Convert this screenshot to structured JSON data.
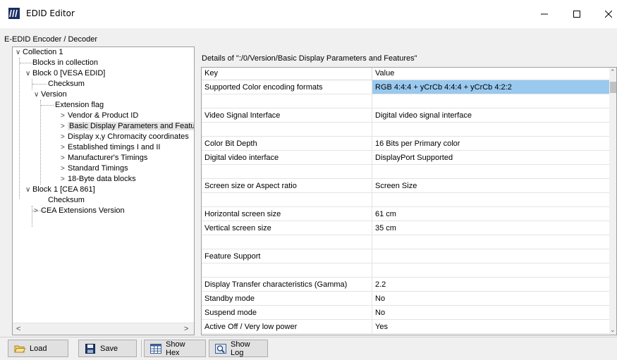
{
  "window": {
    "title": "EDID Editor",
    "subtitle": "E-EDID Encoder / Decoder"
  },
  "tree": {
    "items": [
      {
        "label": "Collection 1",
        "arrow": "∨"
      },
      {
        "label": "Blocks in collection",
        "arrow": ""
      },
      {
        "label": "Block 0 [VESA EDID]",
        "arrow": "∨"
      },
      {
        "label": "Checksum",
        "arrow": ""
      },
      {
        "label": "Version",
        "arrow": "∨"
      },
      {
        "label": "Extension flag",
        "arrow": ""
      },
      {
        "label": "Vendor & Product ID",
        "arrow": ">"
      },
      {
        "label": "Basic Display Parameters and Featu",
        "arrow": ">"
      },
      {
        "label": "Display x,y Chromacity coordinates",
        "arrow": ">"
      },
      {
        "label": "Established timings I and II",
        "arrow": ">"
      },
      {
        "label": "Manufacturer's Timings",
        "arrow": ">"
      },
      {
        "label": "Standard Timings",
        "arrow": ">"
      },
      {
        "label": "18-Byte data blocks",
        "arrow": ">"
      },
      {
        "label": "Block 1 [CEA 861]",
        "arrow": "∨"
      },
      {
        "label": "Checksum",
        "arrow": ""
      },
      {
        "label": "CEA Extensions Version",
        "arrow": ">"
      }
    ],
    "scroll_left": "<",
    "scroll_right": ">"
  },
  "details": {
    "label": "Details of \":/0/Version/Basic Display Parameters and Features\"",
    "col_key": "Key",
    "col_value": "Value",
    "rows": [
      {
        "key": "Supported Color encoding formats",
        "value": "RGB 4:4:4 + yCrCb 4:4:4 + yCrCb 4:2:2"
      },
      {
        "key": "",
        "value": ""
      },
      {
        "key": "Video Signal Interface",
        "value": "Digital video signal interface"
      },
      {
        "key": "",
        "value": ""
      },
      {
        "key": "Color Bit Depth",
        "value": "16 Bits per Primary color"
      },
      {
        "key": "Digital video interface",
        "value": "DisplayPort Supported"
      },
      {
        "key": "",
        "value": ""
      },
      {
        "key": "Screen size or Aspect ratio",
        "value": "Screen Size"
      },
      {
        "key": "",
        "value": ""
      },
      {
        "key": "Horizontal screen size",
        "value": "61 cm"
      },
      {
        "key": "Vertical screen size",
        "value": "35 cm"
      },
      {
        "key": "",
        "value": ""
      },
      {
        "key": "Feature Support",
        "value": ""
      },
      {
        "key": "",
        "value": ""
      },
      {
        "key": "Display Transfer characteristics (Gamma)",
        "value": "2.2"
      },
      {
        "key": "Standby mode",
        "value": "No"
      },
      {
        "key": "Suspend mode",
        "value": "No"
      },
      {
        "key": "Active Off / Very low power",
        "value": "Yes"
      }
    ]
  },
  "buttons": {
    "load": "Load",
    "save": "Save",
    "show_hex": "Show Hex",
    "show_log": "Show Log"
  }
}
